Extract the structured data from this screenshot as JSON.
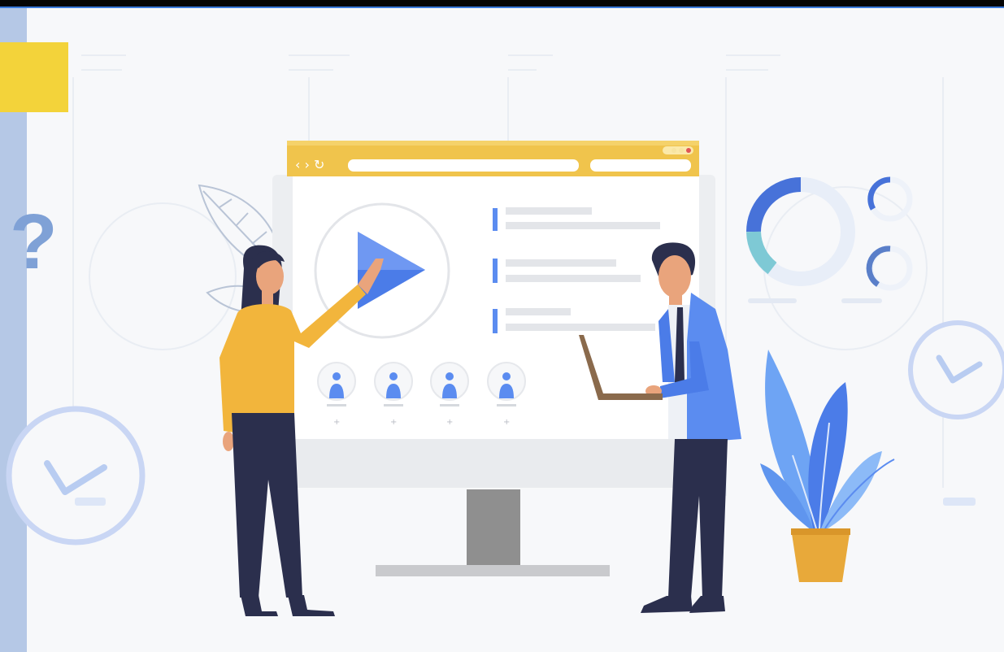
{
  "illustration": {
    "subject": "video-presentation-scene",
    "colors": {
      "background": "#f7f8fa",
      "accent_blue": "#4a7ee6",
      "accent_yellow": "#f3d33a",
      "browser_bar": "#f0c44c",
      "woman_top": "#f2b53c",
      "man_jacket": "#5b8cf0",
      "dark_navy": "#2b2f4d",
      "monitor_stand": "#8f8f8f",
      "plant_pot": "#e8a93a"
    },
    "icons": {
      "play": "play-icon",
      "help": "question-mark-icon",
      "clock": "clock-icon",
      "user": "user-icon"
    }
  }
}
